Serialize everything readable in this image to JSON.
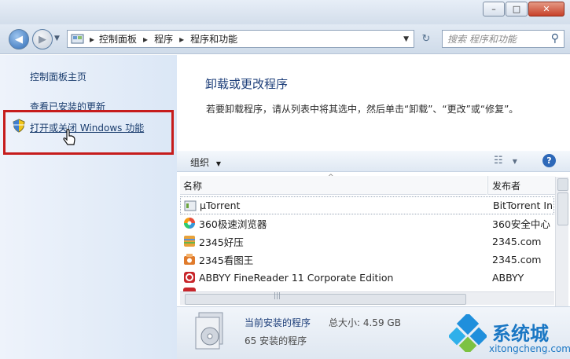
{
  "window": {
    "minimize_label": "–",
    "maximize_label": "□",
    "close_label": "✕"
  },
  "nav": {
    "breadcrumb": [
      "控制面板",
      "程序",
      "程序和功能"
    ],
    "search_placeholder": "搜索 程序和功能"
  },
  "sidebar": {
    "items": [
      {
        "label": "控制面板主页"
      },
      {
        "label": "查看已安装的更新"
      },
      {
        "label": "打开或关闭 Windows 功能"
      }
    ]
  },
  "main": {
    "title": "卸载或更改程序",
    "description": "若要卸载程序，请从列表中将其选中，然后单击“卸载”、“更改”或“修复”。",
    "toolbar": {
      "organize_label": "组织"
    },
    "columns": [
      "名称",
      "发布者"
    ],
    "programs": [
      {
        "name": "µTorrent",
        "publisher": "BitTorrent In"
      },
      {
        "name": "360极速浏览器",
        "publisher": "360安全中心"
      },
      {
        "name": "2345好压",
        "publisher": "2345.com"
      },
      {
        "name": "2345看图王",
        "publisher": "2345.com"
      },
      {
        "name": "ABBYY FineReader 11 Corporate Edition",
        "publisher": "ABBYY"
      }
    ]
  },
  "status": {
    "label": "当前安装的程序",
    "total_label": "总大小: 4.59 GB",
    "count_label": "65 安装的程序"
  },
  "watermark": {
    "brand": "系统城",
    "url": "xitongcheng.com"
  },
  "colors": {
    "link": "#1a3d6e",
    "heading": "#1e3f7a",
    "highlight_box": "#c61c1c"
  }
}
